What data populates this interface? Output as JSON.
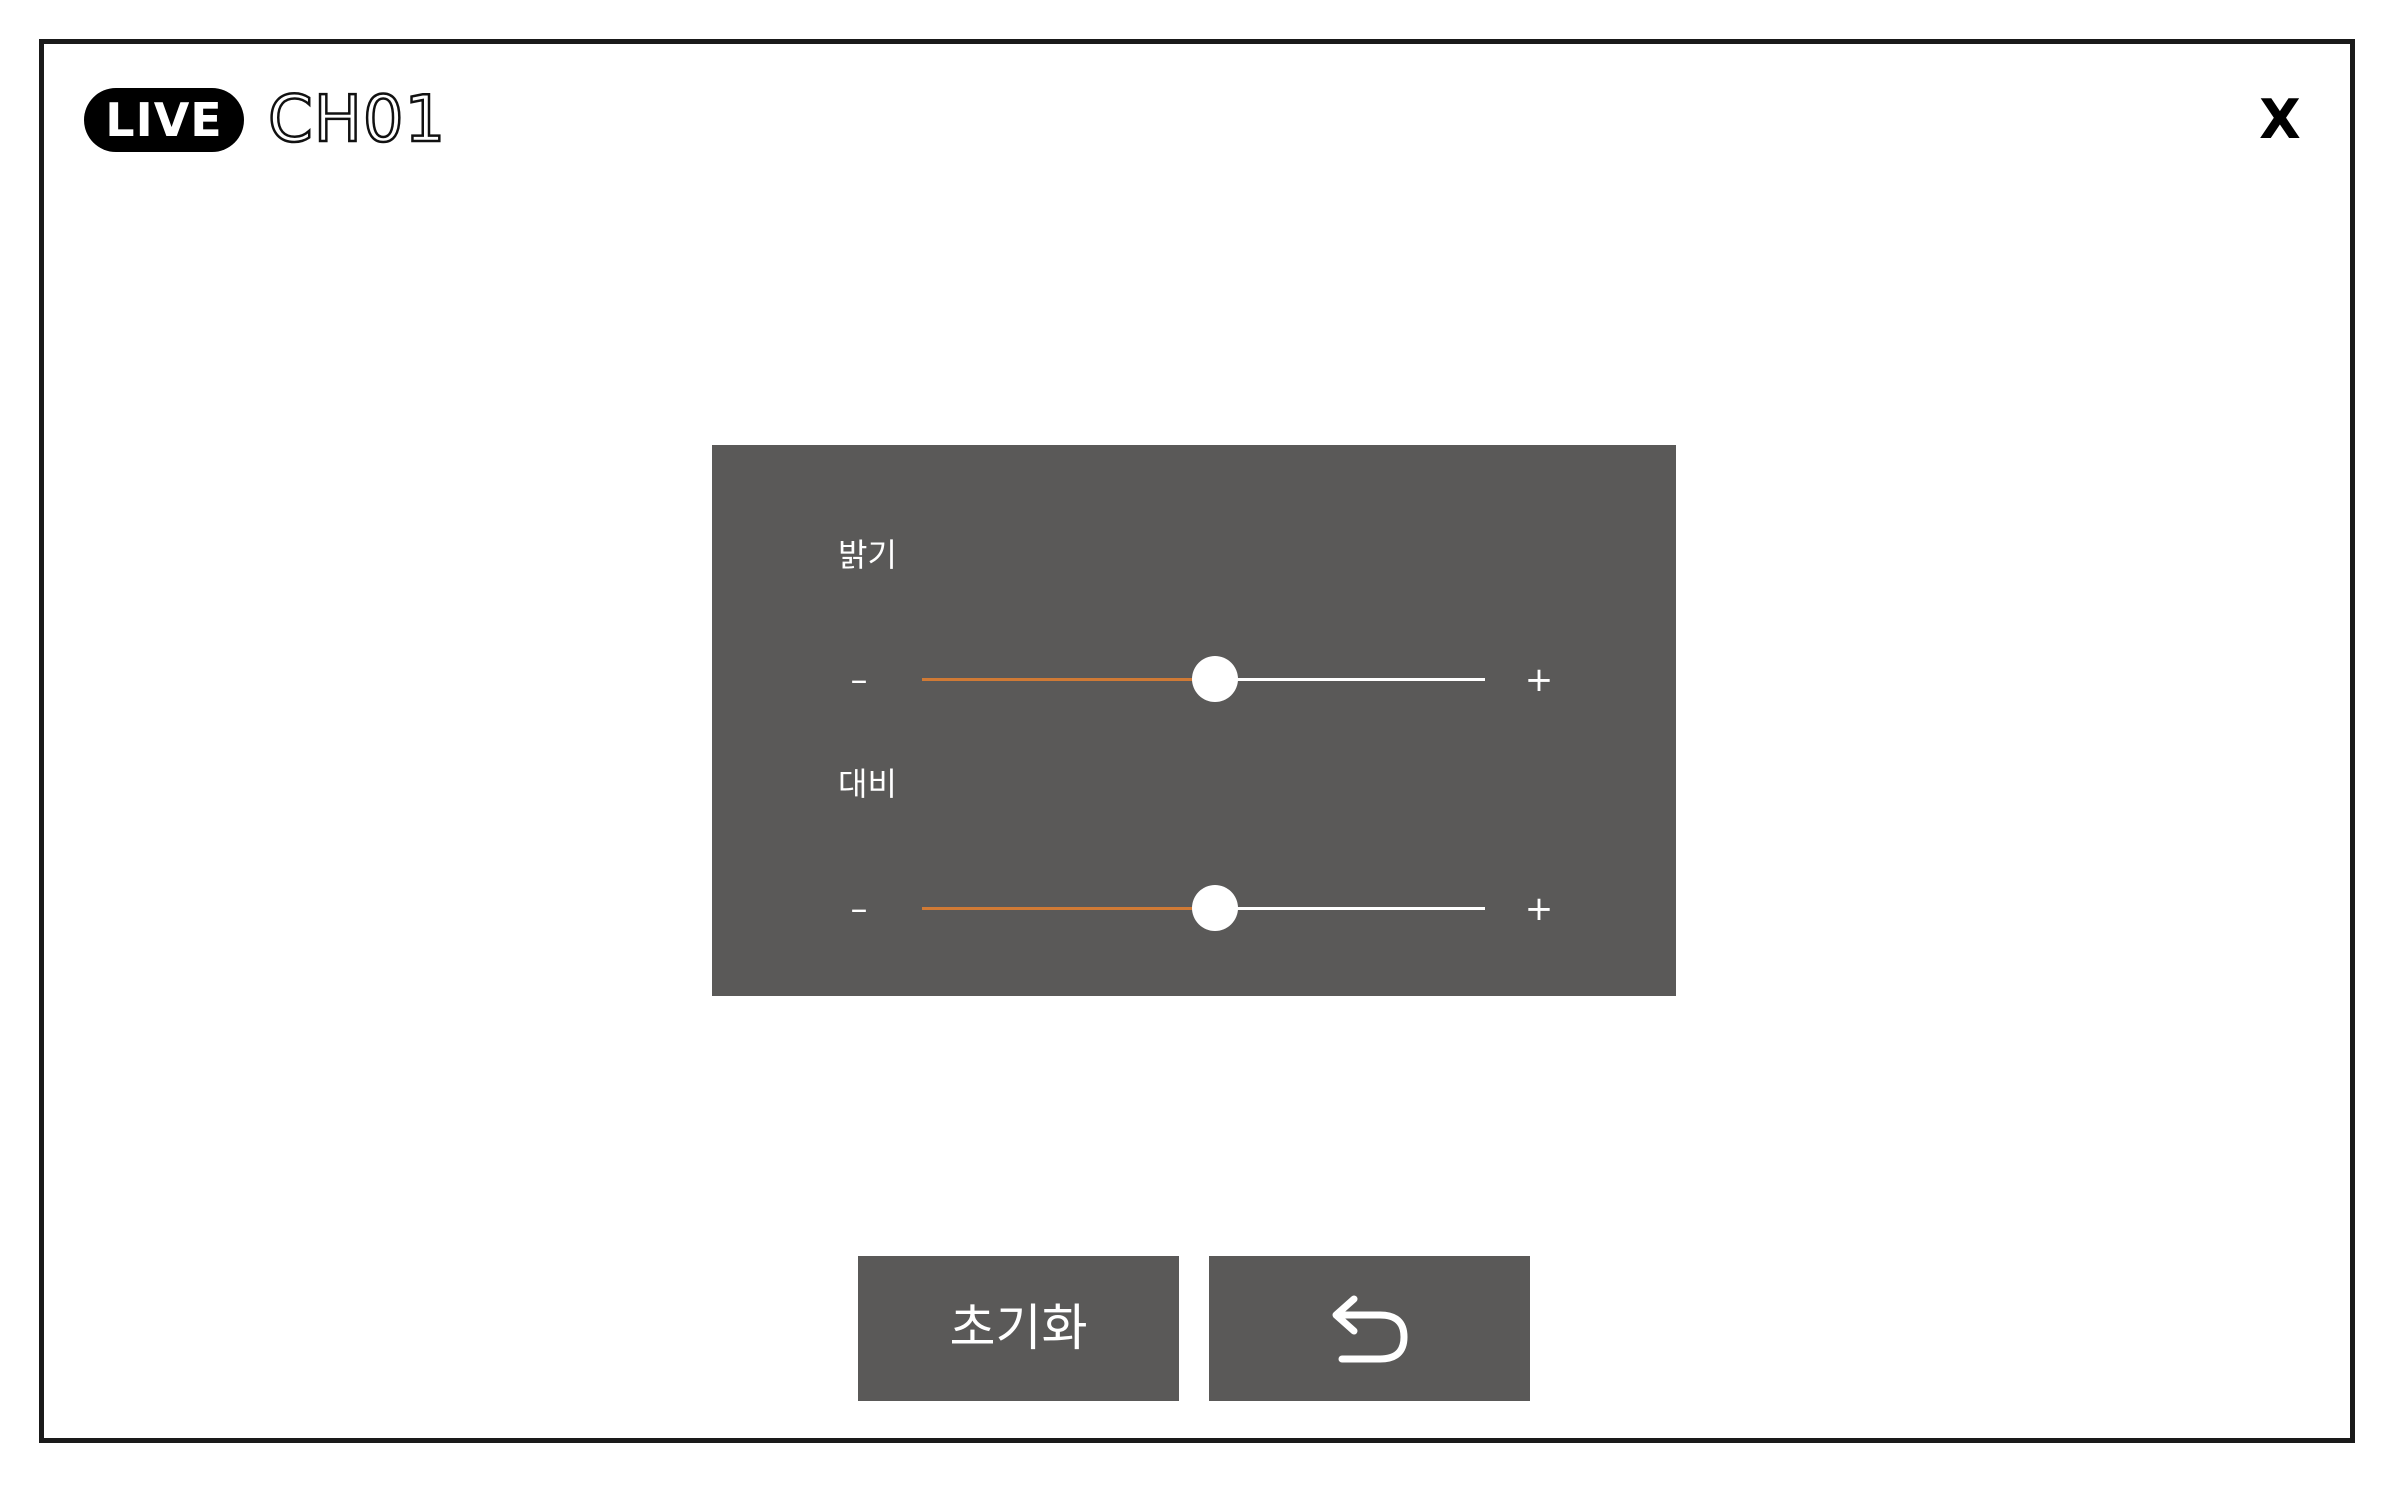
{
  "header": {
    "live_badge": "LIVE",
    "channel": "CH01",
    "close_label": "X"
  },
  "adjust_panel": {
    "sliders": [
      {
        "label": "밝기",
        "minus": "–",
        "plus": "+",
        "value_fraction": 0.52
      },
      {
        "label": "대비",
        "minus": "–",
        "plus": "+",
        "value_fraction": 0.52
      }
    ]
  },
  "buttons": {
    "reset_label": "초기화",
    "back_icon": "undo-arrow-icon"
  },
  "colors": {
    "panel_bg": "#5a5958",
    "slider_fill": "#d07a35",
    "slider_track": "#ffffff",
    "live_badge_bg": "#000000"
  }
}
